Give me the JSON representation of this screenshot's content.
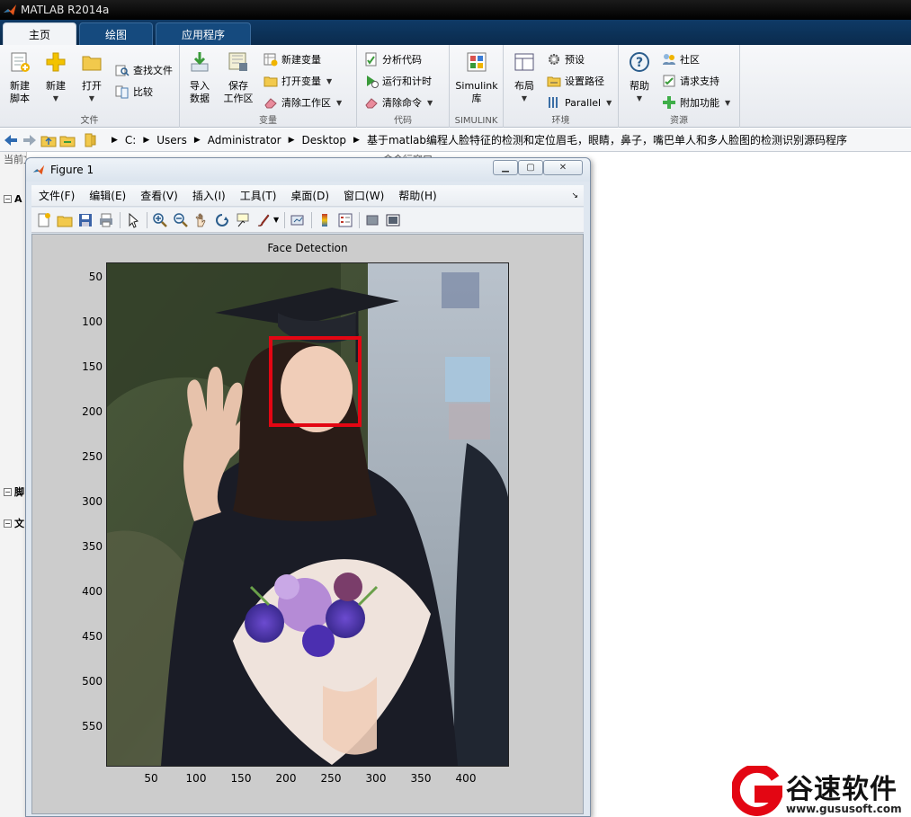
{
  "app": {
    "title": "MATLAB R2014a"
  },
  "tabs": [
    {
      "label": "主页",
      "active": true
    },
    {
      "label": "绘图",
      "active": false
    },
    {
      "label": "应用程序",
      "active": false
    }
  ],
  "ribbon": {
    "file": {
      "group_label": "文件",
      "new_script": "新建\n脚本",
      "new": "新建",
      "open": "打开",
      "find_files": "查找文件",
      "compare": "比较"
    },
    "variable": {
      "group_label": "变量",
      "import_data": "导入\n数据",
      "save_workspace": "保存\n工作区",
      "new_variable": "新建变量",
      "open_variable": "打开变量",
      "clear_workspace": "清除工作区"
    },
    "code": {
      "group_label": "代码",
      "analyze_code": "分析代码",
      "run_and_time": "运行和计时",
      "clear_commands": "清除命令"
    },
    "simulink": {
      "group_label": "SIMULINK",
      "library": "Simulink\n库"
    },
    "environment": {
      "group_label": "环境",
      "layout": "布局",
      "preferences": "预设",
      "set_path": "设置路径",
      "parallel": "Parallel"
    },
    "resources": {
      "group_label": "资源",
      "help": "帮助",
      "community": "社区",
      "request_support": "请求支持",
      "add_ons": "附加功能"
    }
  },
  "address": {
    "crumbs": [
      "C:",
      "Users",
      "Administrator",
      "Desktop",
      "基于matlab编程人脸特征的检测和定位眉毛，眼睛，鼻子，嘴巴单人和多人脸图的检测识别源码程序"
    ]
  },
  "left_pane": {
    "header": "当前文件夹",
    "section_a": "A",
    "section_b": "脚",
    "section_c": "文"
  },
  "command_header": "命令行窗口",
  "figure": {
    "title": "Figure 1",
    "menu": [
      "文件(F)",
      "编辑(E)",
      "查看(V)",
      "插入(I)",
      "工具(T)",
      "桌面(D)",
      "窗口(W)",
      "帮助(H)"
    ],
    "window_buttons": {
      "minimize": "▁",
      "restore": "▢",
      "close": "✕"
    },
    "toolbar_icons": [
      "new-figure-icon",
      "open-file-icon",
      "save-icon",
      "print-icon",
      "pointer-icon",
      "zoom-in-icon",
      "zoom-out-icon",
      "pan-icon",
      "rotate-3d-icon",
      "data-cursor-icon",
      "brush-icon",
      "link-plot-icon",
      "colorbar-icon",
      "legend-icon",
      "hide-plot-tools-icon",
      "show-plot-tools-icon"
    ]
  },
  "chart_data": {
    "type": "image",
    "title": "Face Detection",
    "x_ticks": [
      50,
      100,
      150,
      200,
      250,
      300,
      350,
      400
    ],
    "y_ticks": [
      50,
      100,
      150,
      200,
      250,
      300,
      350,
      400,
      450,
      500,
      550
    ],
    "xlim": [
      0.5,
      448.5
    ],
    "ylim": [
      0.5,
      561.5
    ],
    "face_box": {
      "x": 180,
      "y": 81,
      "width": 103,
      "height": 101,
      "color": "#e30613"
    }
  },
  "watermark": {
    "name": "谷速软件",
    "url": "www.gususoft.com",
    "color": "#e30613"
  }
}
